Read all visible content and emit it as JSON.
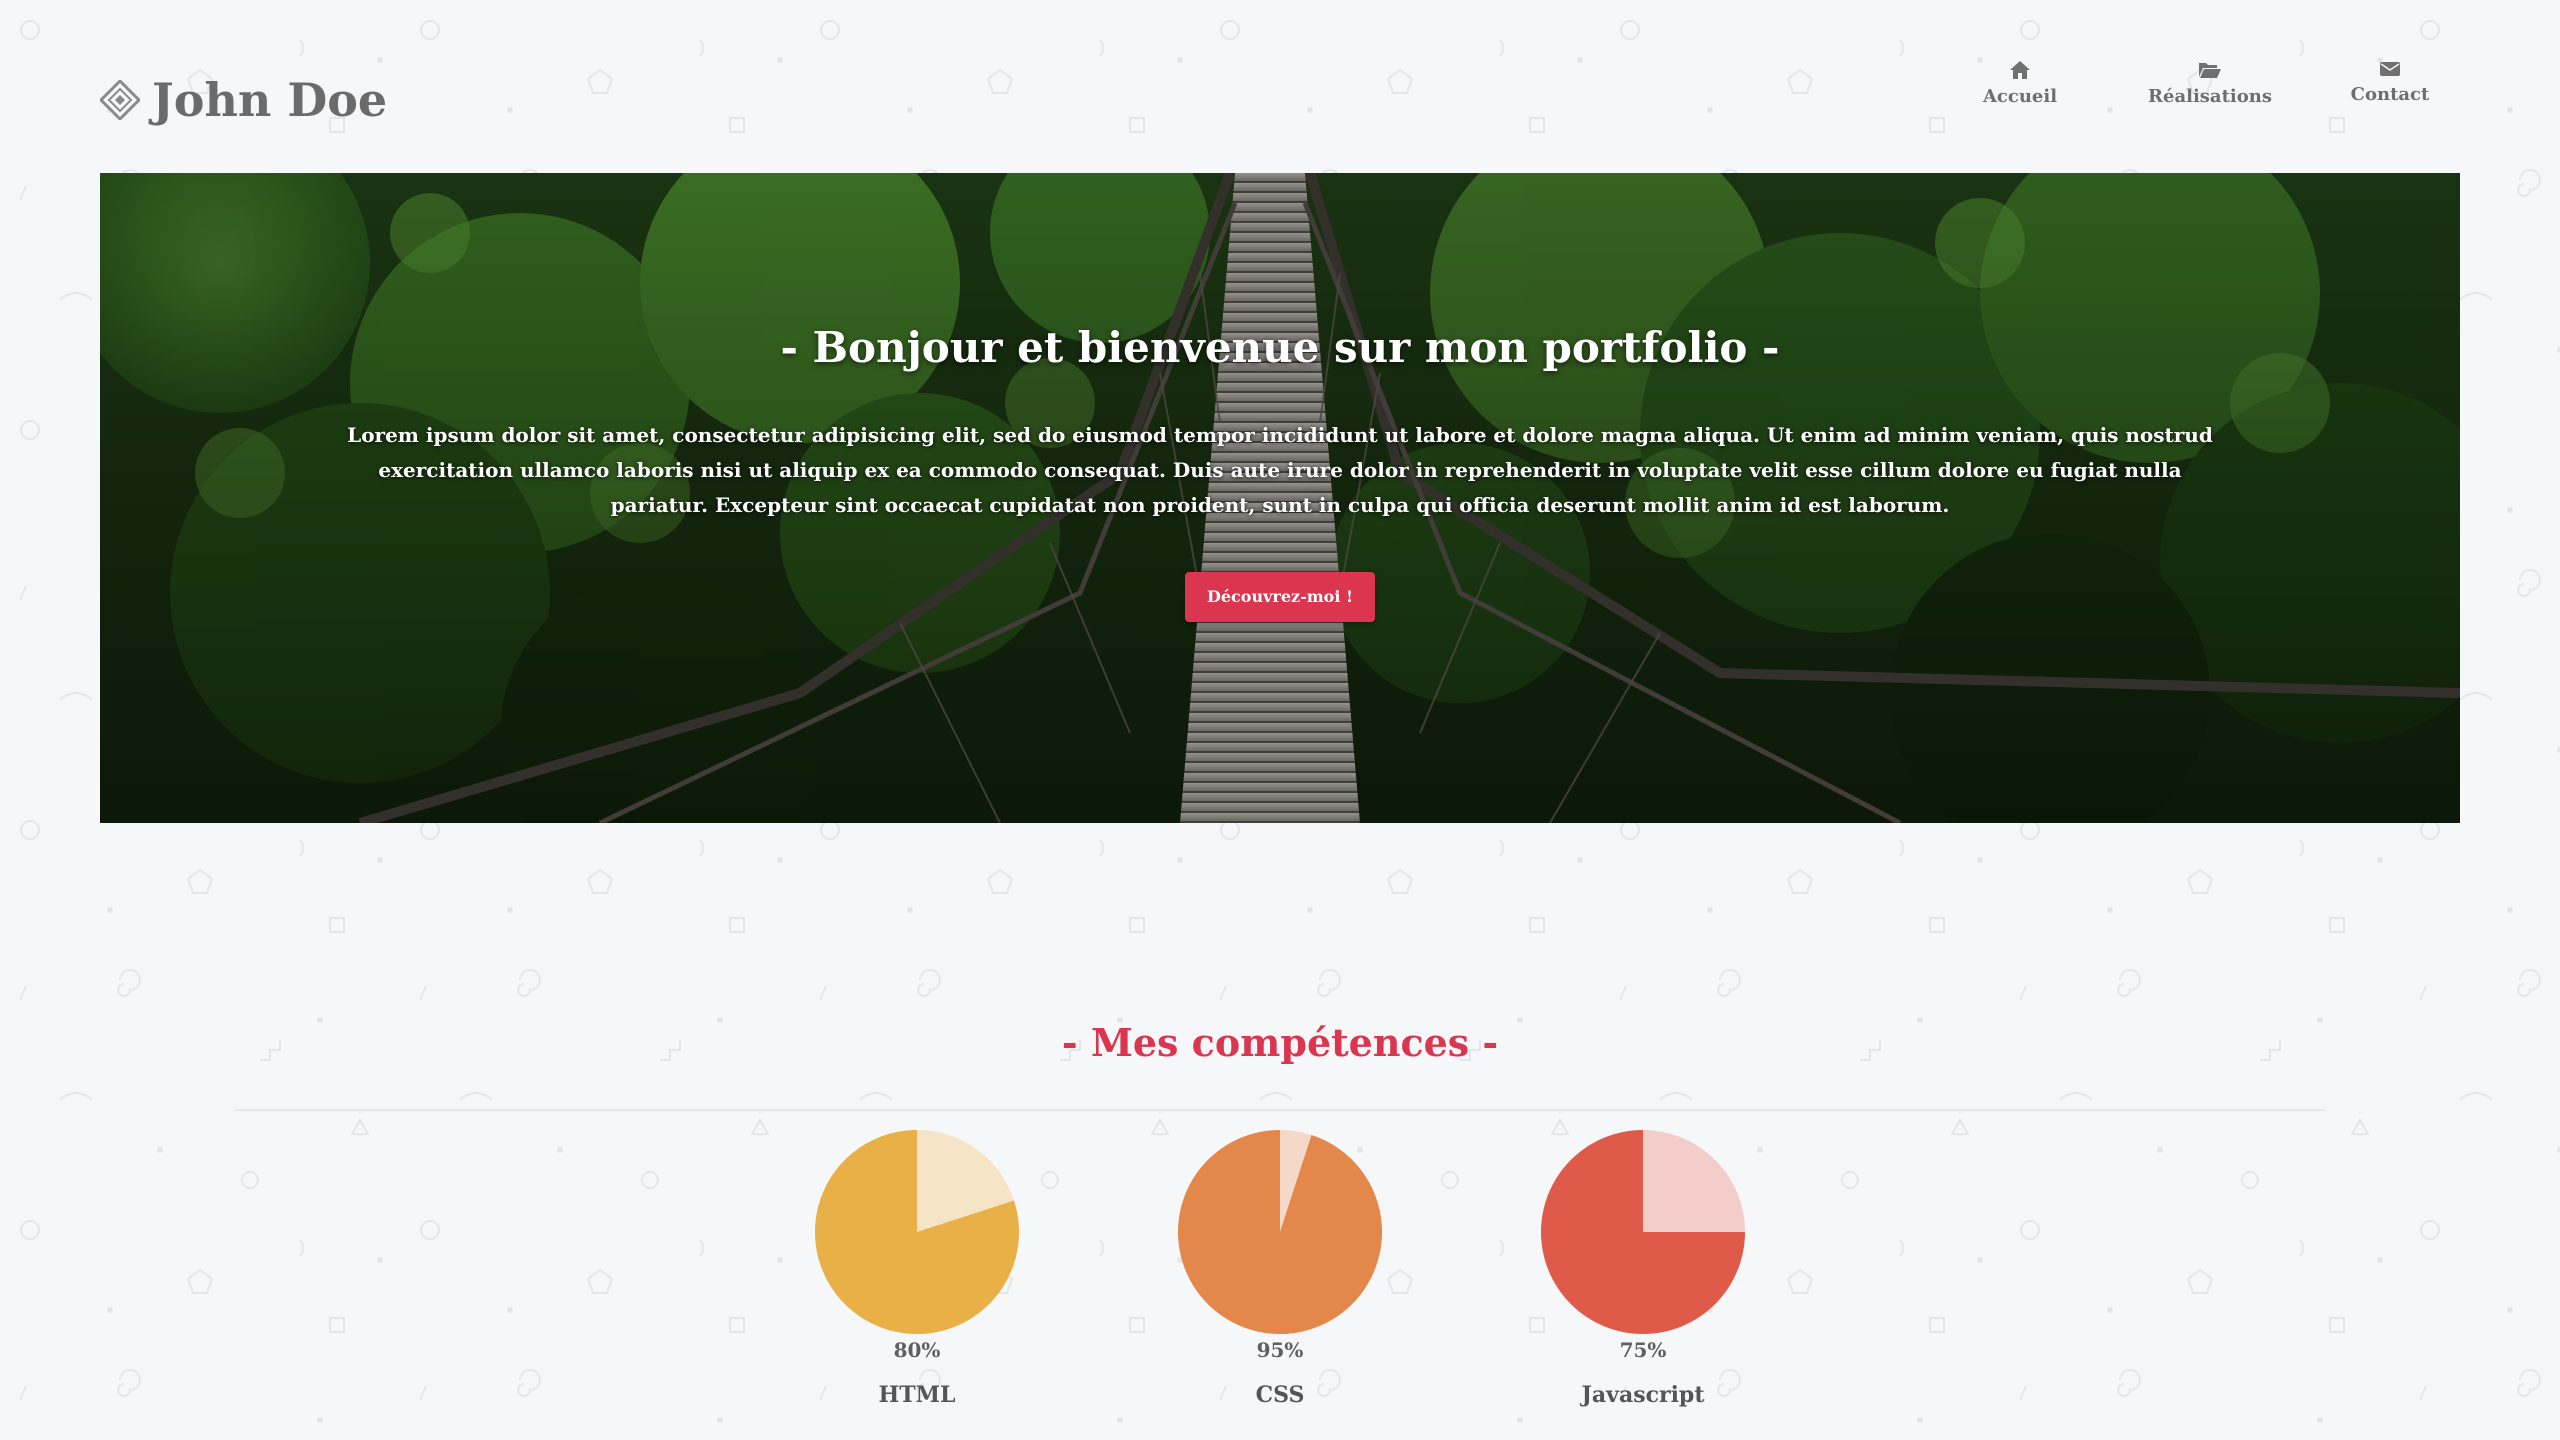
{
  "brand": {
    "name": "John Doe"
  },
  "nav": {
    "items": [
      {
        "label": "Accueil",
        "icon": "home-icon"
      },
      {
        "label": "Réalisations",
        "icon": "folder-open-icon"
      },
      {
        "label": "Contact",
        "icon": "envelope-icon"
      }
    ]
  },
  "hero": {
    "title": "- Bonjour et bienvenue sur mon portfolio -",
    "text": "Lorem ipsum dolor sit amet, consectetur adipisicing elit, sed do eiusmod tempor incididunt ut labore et dolore magna aliqua. Ut enim ad minim veniam, quis nostrud exercitation ullamco laboris nisi ut aliquip ex ea commodo consequat. Duis aute irure dolor in reprehenderit in voluptate velit esse cillum dolore eu fugiat nulla pariatur. Excepteur sint occaecat cupidatat non proident, sunt in culpa qui officia deserunt mollit anim id est laborum.",
    "button_label": "Découvrez-moi !",
    "button_color": "#dc3550"
  },
  "skills": {
    "title": "- Mes compétences -",
    "title_color": "#db3650",
    "items": [
      {
        "name": "HTML",
        "percent_label": "80%",
        "value": 80,
        "color": "#e8b046",
        "light": "#f5e5c6"
      },
      {
        "name": "CSS",
        "percent_label": "95%",
        "value": 95,
        "color": "#e4874a",
        "light": "#f5d9c8"
      },
      {
        "name": "Javascript",
        "percent_label": "75%",
        "value": 75,
        "color": "#e05a4a",
        "light": "#f3cdca"
      }
    ]
  }
}
